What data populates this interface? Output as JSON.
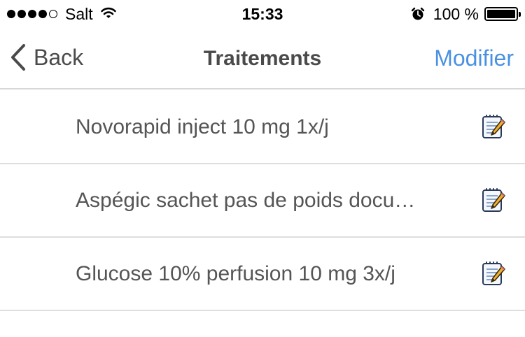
{
  "status_bar": {
    "carrier": "Salt",
    "time": "15:33",
    "battery_percent": "100 %",
    "battery_level": 1.0,
    "signal_bars_filled": 4,
    "signal_bars_total": 5,
    "icons": [
      "signal-dots",
      "wifi-icon",
      "alarm-icon",
      "battery-icon"
    ]
  },
  "nav": {
    "back_label": "Back",
    "title": "Traitements",
    "action_label": "Modifier",
    "accent_color": "#4a90e2"
  },
  "treatments": [
    {
      "label": "Novorapid inject 10 mg 1x/j",
      "icon": "edit-note-icon"
    },
    {
      "label": "Aspégic sachet pas de poids docu…",
      "icon": "edit-note-icon"
    },
    {
      "label": "Glucose 10% perfusion 10 mg 3x/j",
      "icon": "edit-note-icon"
    }
  ]
}
